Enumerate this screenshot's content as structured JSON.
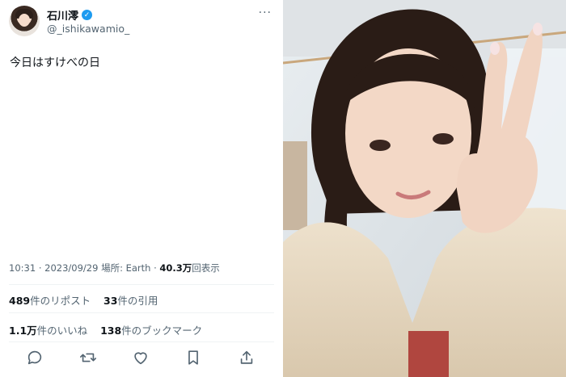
{
  "user": {
    "display_name": "石川澪",
    "handle": "@_ishikawamio_",
    "verified_icon": "verified-badge-icon",
    "more_label": "···"
  },
  "tweet": {
    "text": "今日はすけべの日"
  },
  "meta": {
    "time": "10:31",
    "separator": "·",
    "date": "2023/09/29",
    "location_label": "場所:",
    "location": "Earth",
    "separator2": "·",
    "views_count": "40.3万",
    "views_label": "回表示"
  },
  "stats": {
    "reposts_count": "489",
    "reposts_label": "件のリポスト",
    "quotes_count": "33",
    "quotes_label": "件の引用",
    "likes_count": "1.1万",
    "likes_label": "件のいいね",
    "bookmarks_count": "138",
    "bookmarks_label": "件のブックマーク"
  },
  "actions": [
    "reply-icon",
    "retweet-icon",
    "like-icon",
    "bookmark-icon",
    "share-icon"
  ],
  "colors": {
    "accent": "#1d9bf0",
    "secondary_text": "#536471",
    "primary_text": "#0f1419",
    "divider": "#eff3f4"
  }
}
